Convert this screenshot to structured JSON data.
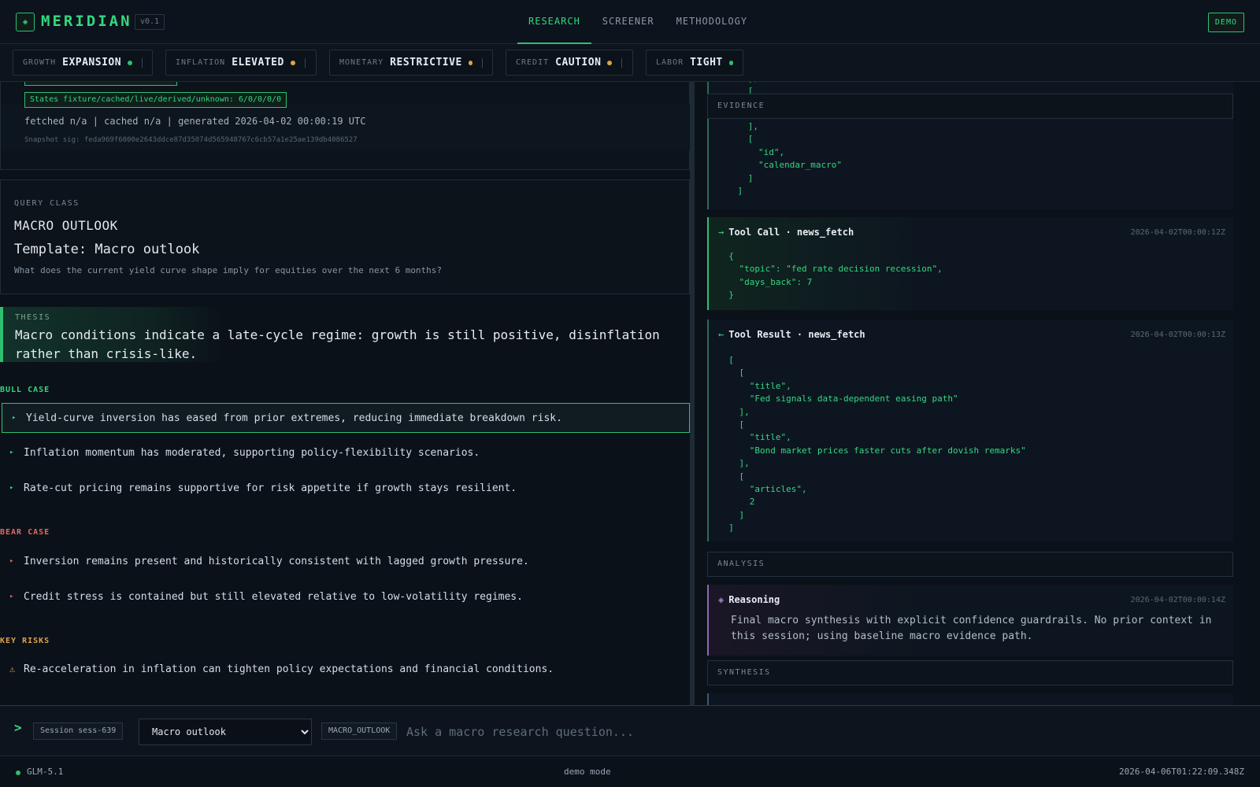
{
  "app": {
    "logo_glyph": "◈",
    "brand": "MERIDIAN",
    "version": "v0.1",
    "demo_label": "DEMO"
  },
  "nav": {
    "tabs": [
      {
        "label": "RESEARCH",
        "active": true
      },
      {
        "label": "SCREENER",
        "active": false
      },
      {
        "label": "METHODOLOGY",
        "active": false
      }
    ]
  },
  "regime": [
    {
      "label": "GROWTH",
      "value": "EXPANSION",
      "status_color": "#2fbf71"
    },
    {
      "label": "INFLATION",
      "value": "ELEVATED",
      "status_color": "#e0a14a"
    },
    {
      "label": "MONETARY",
      "value": "RESTRICTIVE",
      "status_color": "#e0a14a"
    },
    {
      "label": "CREDIT",
      "value": "CAUTION",
      "status_color": "#e0a14a"
    },
    {
      "label": "LABOR",
      "value": "TIGHT",
      "status_color": "#2fbf71"
    }
  ],
  "meta": {
    "states": "States fixture/cached/live/derived/unknown: 6/0/0/0/0",
    "times": "fetched n/a | cached n/a | generated 2026-04-02 00:00:19 UTC",
    "signature": "Snapshot sig: feda969f6000e2643ddce87d35074d565948767c6cb57a1e25ae139db4086527"
  },
  "query": {
    "label": "QUERY CLASS",
    "class_name": "MACRO OUTLOOK",
    "template": "Template: Macro outlook",
    "question": "What does the current yield curve shape imply for equities over the next 6 months?"
  },
  "thesis": {
    "label": "THESIS",
    "line1": "Macro conditions indicate a late-cycle regime: growth is still positive, disinflation",
    "line2": "rather than crisis-like."
  },
  "bull": {
    "label": "BULL CASE",
    "marker": "▸",
    "items": [
      "Yield-curve inversion has eased from prior extremes, reducing immediate breakdown risk.",
      "Inflation momentum has moderated, supporting policy-flexibility scenarios.",
      "Rate-cut pricing remains supportive for risk appetite if growth stays resilient."
    ]
  },
  "bear": {
    "label": "BEAR CASE",
    "marker": "▸",
    "items": [
      "Inversion remains present and historically consistent with lagged growth pressure.",
      "Credit stress is contained but still elevated relative to low-volatility regimes."
    ]
  },
  "risks": {
    "label": "KEY RISKS",
    "marker": "⚠",
    "items": [
      "Re-acceleration in inflation can tighten policy expectations and financial conditions."
    ]
  },
  "trace": {
    "evidence_label": "EVIDENCE",
    "analysis_label": "ANALYSIS",
    "synthesis_label": "SYNTHESIS",
    "evidence_tail": "      ],\n      [\n        \"id\",\n        \"calendar_macro\"\n      ]\n    ]",
    "evidence_top": "      ],\n      [",
    "tool_call": {
      "arrow": "→",
      "title": "Tool Call · news_fetch",
      "time": "2026-04-02T00:00:12Z",
      "body": "  {\n    \"topic\": \"fed rate decision recession\",\n    \"days_back\": 7\n  }"
    },
    "tool_result": {
      "arrow": "←",
      "title": "Tool Result · news_fetch",
      "time": "2026-04-02T00:00:13Z",
      "body": "  [\n    [\n      \"title\",\n      \"Fed signals data-dependent easing path\"\n    ],\n    [\n      \"title\",\n      \"Bond market prices faster cuts after dovish remarks\"\n    ],\n    [\n      \"articles\",\n      2\n    ]\n  ]"
    },
    "reasoning": {
      "glyph": "◈",
      "title": "Reasoning",
      "time": "2026-04-02T00:00:14Z",
      "text": "Final macro synthesis with explicit confidence guardrails. No prior context in this session; using baseline macro evidence path."
    }
  },
  "command": {
    "prompt": ">",
    "session": "Session sess-639",
    "template_selected": "Macro outlook",
    "class_chip": "MACRO_OUTLOOK",
    "placeholder": "Ask a macro research question..."
  },
  "status": {
    "model": "GLM-5.1",
    "mode": "demo mode",
    "clock": "2026-04-06T01:22:09.348Z"
  }
}
